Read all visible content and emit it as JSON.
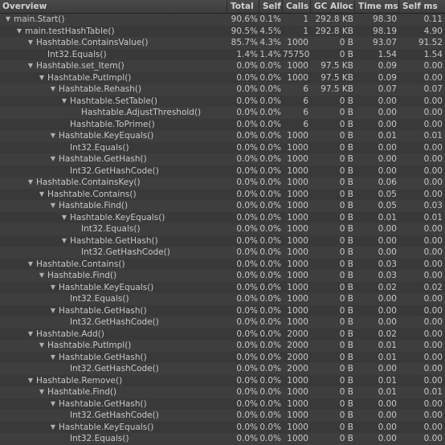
{
  "header": {
    "name": "Overview",
    "total": "Total",
    "self": "Self",
    "calls": "Calls",
    "gc": "GC Alloc",
    "time": "Time ms",
    "selfms": "Self ms"
  },
  "rows": [
    {
      "name": "main.Start()",
      "level": 0,
      "expanded": true,
      "total": "90.6%",
      "self": "0.1%",
      "calls": "1",
      "gc": "292.8 KB",
      "time": "98.30",
      "selfms": "0.11"
    },
    {
      "name": "main.testHashTable()",
      "level": 1,
      "expanded": true,
      "total": "90.5%",
      "self": "4.5%",
      "calls": "1",
      "gc": "292.8 KB",
      "time": "98.19",
      "selfms": "4.90"
    },
    {
      "name": "Hashtable.ContainsValue()",
      "level": 2,
      "expanded": true,
      "total": "85.7%",
      "self": "4.3%",
      "calls": "1000",
      "gc": "0 B",
      "time": "93.07",
      "selfms": "91.52"
    },
    {
      "name": "Int32.Equals()",
      "level": 3,
      "expanded": false,
      "total": "1.4%",
      "self": "1.4%",
      "calls": "75750",
      "gc": "0 B",
      "time": "1.54",
      "selfms": "1.54"
    },
    {
      "name": "Hashtable.set_Item()",
      "level": 2,
      "expanded": true,
      "total": "0.0%",
      "self": "0.0%",
      "calls": "1000",
      "gc": "97.5 KB",
      "time": "0.09",
      "selfms": "0.00"
    },
    {
      "name": "Hashtable.PutImpl()",
      "level": 3,
      "expanded": true,
      "total": "0.0%",
      "self": "0.0%",
      "calls": "1000",
      "gc": "97.5 KB",
      "time": "0.09",
      "selfms": "0.00"
    },
    {
      "name": "Hashtable.Rehash()",
      "level": 4,
      "expanded": true,
      "total": "0.0%",
      "self": "0.0%",
      "calls": "6",
      "gc": "97.5 KB",
      "time": "0.07",
      "selfms": "0.07"
    },
    {
      "name": "Hashtable.SetTable()",
      "level": 5,
      "expanded": true,
      "total": "0.0%",
      "self": "0.0%",
      "calls": "6",
      "gc": "0 B",
      "time": "0.00",
      "selfms": "0.00"
    },
    {
      "name": "Hashtable.AdjustThreshold()",
      "level": 6,
      "expanded": false,
      "total": "0.0%",
      "self": "0.0%",
      "calls": "6",
      "gc": "0 B",
      "time": "0.00",
      "selfms": "0.00"
    },
    {
      "name": "Hashtable.ToPrime()",
      "level": 5,
      "expanded": false,
      "total": "0.0%",
      "self": "0.0%",
      "calls": "6",
      "gc": "0 B",
      "time": "0.00",
      "selfms": "0.00"
    },
    {
      "name": "Hashtable.KeyEquals()",
      "level": 4,
      "expanded": true,
      "total": "0.0%",
      "self": "0.0%",
      "calls": "1000",
      "gc": "0 B",
      "time": "0.01",
      "selfms": "0.01"
    },
    {
      "name": "Int32.Equals()",
      "level": 5,
      "expanded": false,
      "total": "0.0%",
      "self": "0.0%",
      "calls": "1000",
      "gc": "0 B",
      "time": "0.00",
      "selfms": "0.00"
    },
    {
      "name": "Hashtable.GetHash()",
      "level": 4,
      "expanded": true,
      "total": "0.0%",
      "self": "0.0%",
      "calls": "1000",
      "gc": "0 B",
      "time": "0.00",
      "selfms": "0.00"
    },
    {
      "name": "Int32.GetHashCode()",
      "level": 5,
      "expanded": false,
      "total": "0.0%",
      "self": "0.0%",
      "calls": "1000",
      "gc": "0 B",
      "time": "0.00",
      "selfms": "0.00"
    },
    {
      "name": "Hashtable.ContainsKey()",
      "level": 2,
      "expanded": true,
      "total": "0.0%",
      "self": "0.0%",
      "calls": "1000",
      "gc": "0 B",
      "time": "0.06",
      "selfms": "0.00"
    },
    {
      "name": "Hashtable.Contains()",
      "level": 3,
      "expanded": true,
      "total": "0.0%",
      "self": "0.0%",
      "calls": "1000",
      "gc": "0 B",
      "time": "0.05",
      "selfms": "0.00"
    },
    {
      "name": "Hashtable.Find()",
      "level": 4,
      "expanded": true,
      "total": "0.0%",
      "self": "0.0%",
      "calls": "1000",
      "gc": "0 B",
      "time": "0.05",
      "selfms": "0.03"
    },
    {
      "name": "Hashtable.KeyEquals()",
      "level": 5,
      "expanded": true,
      "total": "0.0%",
      "self": "0.0%",
      "calls": "1000",
      "gc": "0 B",
      "time": "0.01",
      "selfms": "0.01"
    },
    {
      "name": "Int32.Equals()",
      "level": 6,
      "expanded": false,
      "total": "0.0%",
      "self": "0.0%",
      "calls": "1000",
      "gc": "0 B",
      "time": "0.00",
      "selfms": "0.00"
    },
    {
      "name": "Hashtable.GetHash()",
      "level": 5,
      "expanded": true,
      "total": "0.0%",
      "self": "0.0%",
      "calls": "1000",
      "gc": "0 B",
      "time": "0.00",
      "selfms": "0.00"
    },
    {
      "name": "Int32.GetHashCode()",
      "level": 6,
      "expanded": false,
      "total": "0.0%",
      "self": "0.0%",
      "calls": "1000",
      "gc": "0 B",
      "time": "0.00",
      "selfms": "0.00"
    },
    {
      "name": "Hashtable.Contains()",
      "level": 2,
      "expanded": true,
      "total": "0.0%",
      "self": "0.0%",
      "calls": "1000",
      "gc": "0 B",
      "time": "0.03",
      "selfms": "0.00"
    },
    {
      "name": "Hashtable.Find()",
      "level": 3,
      "expanded": true,
      "total": "0.0%",
      "self": "0.0%",
      "calls": "1000",
      "gc": "0 B",
      "time": "0.03",
      "selfms": "0.00"
    },
    {
      "name": "Hashtable.KeyEquals()",
      "level": 4,
      "expanded": true,
      "total": "0.0%",
      "self": "0.0%",
      "calls": "1000",
      "gc": "0 B",
      "time": "0.02",
      "selfms": "0.02"
    },
    {
      "name": "Int32.Equals()",
      "level": 5,
      "expanded": false,
      "total": "0.0%",
      "self": "0.0%",
      "calls": "1000",
      "gc": "0 B",
      "time": "0.00",
      "selfms": "0.00"
    },
    {
      "name": "Hashtable.GetHash()",
      "level": 4,
      "expanded": true,
      "total": "0.0%",
      "self": "0.0%",
      "calls": "1000",
      "gc": "0 B",
      "time": "0.00",
      "selfms": "0.00"
    },
    {
      "name": "Int32.GetHashCode()",
      "level": 5,
      "expanded": false,
      "total": "0.0%",
      "self": "0.0%",
      "calls": "1000",
      "gc": "0 B",
      "time": "0.00",
      "selfms": "0.00"
    },
    {
      "name": "Hashtable.Add()",
      "level": 2,
      "expanded": true,
      "total": "0.0%",
      "self": "0.0%",
      "calls": "2000",
      "gc": "0 B",
      "time": "0.02",
      "selfms": "0.00"
    },
    {
      "name": "Hashtable.PutImpl()",
      "level": 3,
      "expanded": true,
      "total": "0.0%",
      "self": "0.0%",
      "calls": "2000",
      "gc": "0 B",
      "time": "0.01",
      "selfms": "0.00"
    },
    {
      "name": "Hashtable.GetHash()",
      "level": 4,
      "expanded": true,
      "total": "0.0%",
      "self": "0.0%",
      "calls": "2000",
      "gc": "0 B",
      "time": "0.01",
      "selfms": "0.00"
    },
    {
      "name": "Int32.GetHashCode()",
      "level": 5,
      "expanded": false,
      "total": "0.0%",
      "self": "0.0%",
      "calls": "2000",
      "gc": "0 B",
      "time": "0.00",
      "selfms": "0.00"
    },
    {
      "name": "Hashtable.Remove()",
      "level": 2,
      "expanded": true,
      "total": "0.0%",
      "self": "0.0%",
      "calls": "1000",
      "gc": "0 B",
      "time": "0.01",
      "selfms": "0.00"
    },
    {
      "name": "Hashtable.Find()",
      "level": 3,
      "expanded": true,
      "total": "0.0%",
      "self": "0.0%",
      "calls": "1000",
      "gc": "0 B",
      "time": "0.01",
      "selfms": "0.01"
    },
    {
      "name": "Hashtable.GetHash()",
      "level": 4,
      "expanded": true,
      "total": "0.0%",
      "self": "0.0%",
      "calls": "1000",
      "gc": "0 B",
      "time": "0.00",
      "selfms": "0.00"
    },
    {
      "name": "Int32.GetHashCode()",
      "level": 5,
      "expanded": false,
      "total": "0.0%",
      "self": "0.0%",
      "calls": "1000",
      "gc": "0 B",
      "time": "0.00",
      "selfms": "0.00"
    },
    {
      "name": "Hashtable.KeyEquals()",
      "level": 4,
      "expanded": true,
      "total": "0.0%",
      "self": "0.0%",
      "calls": "1000",
      "gc": "0 B",
      "time": "0.00",
      "selfms": "0.00"
    },
    {
      "name": "Int32.Equals()",
      "level": 5,
      "expanded": false,
      "total": "0.0%",
      "self": "0.0%",
      "calls": "1000",
      "gc": "0 B",
      "time": "0.00",
      "selfms": "0.00"
    }
  ]
}
